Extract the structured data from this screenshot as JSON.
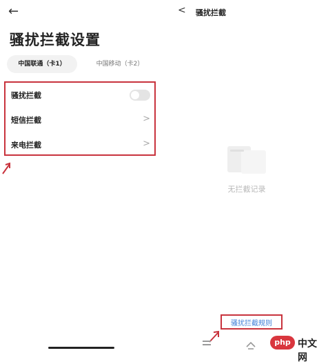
{
  "left": {
    "title": "骚扰拦截设置",
    "tabs": [
      {
        "label": "中国联通（卡1）",
        "active": true
      },
      {
        "label": "中国移动（卡2）",
        "active": false
      }
    ],
    "rows": [
      {
        "label": "骚扰拦截",
        "control": "toggle",
        "enabled": false
      },
      {
        "label": "短信拦截",
        "control": "chevron"
      },
      {
        "label": "来电拦截",
        "control": "chevron"
      }
    ]
  },
  "right": {
    "title": "骚扰拦截",
    "empty_text": "无拦截记录",
    "rules_link": "骚扰拦截规则"
  },
  "watermark": {
    "badge": "php",
    "text": "中文网"
  },
  "colors": {
    "annotation_red": "#c8323c",
    "link_blue": "#3d7fd8"
  }
}
